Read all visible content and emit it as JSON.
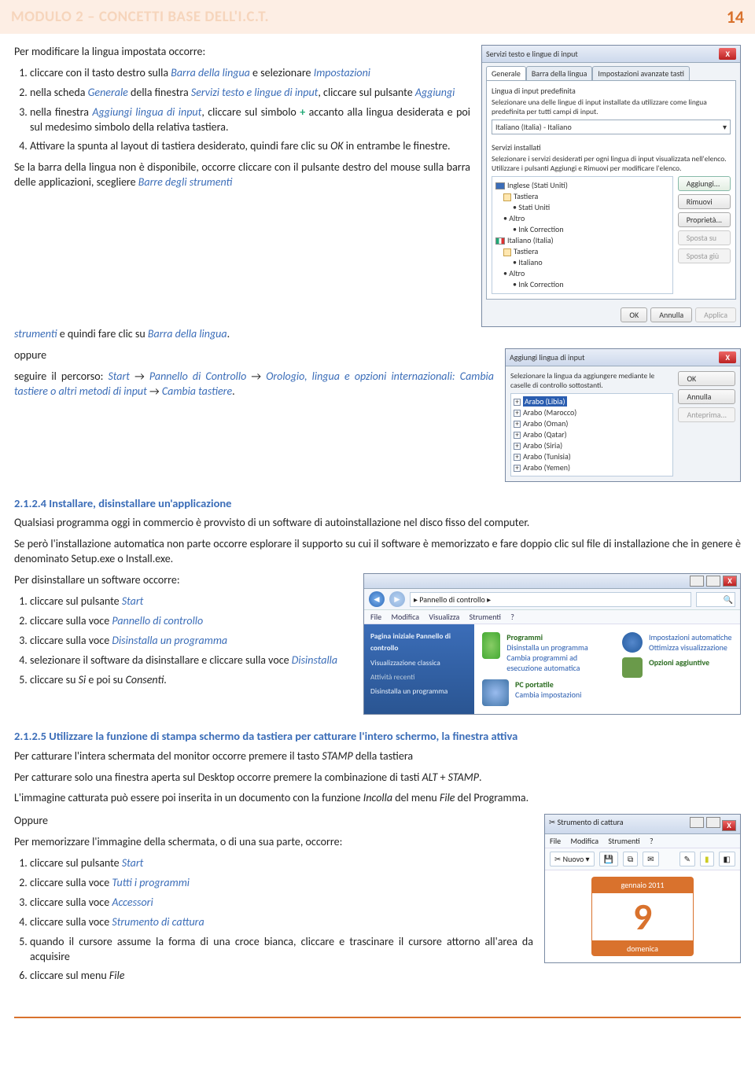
{
  "header": {
    "title": "MODULO 2 – CONCETTI BASE DELL'I.C.T.",
    "page": "14"
  },
  "intro": "Per modificare la lingua impostata occorre:",
  "steps1": {
    "s1a": "cliccare con il tasto destro sulla ",
    "s1b": "Barra della lingua",
    "s1c": " e selezionare ",
    "s1d": "Impostazioni",
    "s2a": "nella scheda ",
    "s2b": "Generale",
    "s2c": " della finestra ",
    "s2d": "Servizi testo e lingue di input",
    "s2e": ", cliccare sul pulsante ",
    "s2f": "Aggiungi",
    "s3a": "nella finestra ",
    "s3b": "Aggiungi lingua di input",
    "s3c": ", cliccare sul simbolo ",
    "s3plus": "+",
    "s3d": " accanto alla lingua desiderata e poi sul medesimo simbolo della relativa tastiera.",
    "s4a": "Attivare la spunta al layout di tastiera desiderato, quindi fare clic su ",
    "s4b": "OK",
    "s4c": " in entrambe le finestre."
  },
  "para1": {
    "a": "Se la barra della lingua non è disponibile, occorre cliccare con il pulsante destro del mouse sulla barra delle applicazioni, scegliere ",
    "b": "Barre degli strumenti",
    "c": " e quindi fare clic su ",
    "d": "Barra della lingua",
    "e": "."
  },
  "para2": {
    "a": "oppure",
    "b": "seguire il percorso: ",
    "c": "Start",
    "d": " → ",
    "e": "Pannello di Controllo",
    "f": " → ",
    "g": "Orologio, lingua e opzioni internazionali: Cambia tastiere o altri metodi di input",
    "h": " → ",
    "i": "Cambia tastiere",
    "j": "."
  },
  "sec4": {
    "hdr": "2.1.2.4  Installare, disinstallare un'applicazione",
    "p1": "Qualsiasi programma oggi in commercio è provvisto di un software di autoinstallazione nel disco fisso del computer.",
    "p2": "Se però l'installazione automatica non parte occorre esplorare il supporto su cui il software è memorizzato e fare doppio clic sul file di installazione che in genere è denominato Setup.exe o Install.exe.",
    "p3": "Per disinstallare un software occorre:",
    "li1a": "cliccare sul pulsante ",
    "li1b": "Start",
    "li2a": "cliccare sulla voce ",
    "li2b": "Pannello di controllo",
    "li3a": "cliccare sulla voce ",
    "li3b": "Disinstalla un programma",
    "li4a": "selezionare il software da disinstallare  e cliccare sulla voce ",
    "li4b": "Disinstalla",
    "li5a": "cliccare su ",
    "li5b": "Si",
    "li5c": " e poi su ",
    "li5d": "Consenti",
    "li5e": "."
  },
  "sec5": {
    "hdr": "2.1.2.5  Utilizzare la funzione di stampa schermo da tastiera per catturare l'intero schermo, la finestra attiva",
    "p1a": "Per catturare l'intera schermata del monitor occorre premere il tasto ",
    "p1b": "STAMP",
    "p1c": " della tastiera",
    "p2a": "Per catturare solo una finestra aperta sul Desktop occorre premere la combinazione di tasti ",
    "p2b": "ALT",
    "p2c": " + ",
    "p2d": "STAMP",
    "p2e": ".",
    "p3a": "L'immagine catturata può essere poi inserita in un documento con la funzione ",
    "p3b": "Incolla",
    "p3c": " del menu ",
    "p3d": "File",
    "p3e": " del Programma.",
    "opp": "Oppure",
    "p4": "Per memorizzare l'immagine della schermata, o di una sua parte, occorre:",
    "li1a": "cliccare sul pulsante ",
    "li1b": "Start",
    "li2a": "cliccare sulla voce ",
    "li2b": "Tutti i programmi",
    "li3a": "cliccare sulla voce ",
    "li3b": "Accessori",
    "li4a": "cliccare sulla voce ",
    "li4b": "Strumento di cattura",
    "li5": "quando il cursore assume la forma di una croce bianca, cliccare e trascinare il cursore attorno all'area da acquisire",
    "li6a": "cliccare sul menu ",
    "li6b": "File"
  },
  "dlg1": {
    "title": "Servizi testo e lingue di input",
    "tabs": [
      "Generale",
      "Barra della lingua",
      "Impostazioni avanzate tasti"
    ],
    "grp1": "Lingua di input predefinita",
    "grp1txt": "Selezionare una delle lingue di input installate da utilizzare come lingua predefinita per tutti campi di input.",
    "combo": "Italiano (Italia) - Italiano",
    "grp2": "Servizi installati",
    "grp2txt": "Selezionare i servizi desiderati per ogni lingua di input visualizzata nell'elenco. Utilizzare i pulsanti Aggiungi e Rimuovi per modificare l'elenco.",
    "tree": {
      "en": "Inglese (Stati Uniti)",
      "ent": "Tastiera",
      "ens": "Stati Uniti",
      "alt": "Altro",
      "ink": "Ink Correction",
      "it": "Italiano (Italia)",
      "itt": "Tastiera",
      "its": "Italiano"
    },
    "btns": {
      "add": "Aggiungi...",
      "rem": "Rimuovi",
      "prop": "Proprietà...",
      "up": "Sposta su",
      "dn": "Sposta giù"
    },
    "ok": "OK",
    "cancel": "Annulla",
    "apply": "Applica"
  },
  "dlg2": {
    "title": "Aggiungi lingua di input",
    "txt": "Selezionare la lingua da aggiungere mediante le caselle di controllo sottostanti.",
    "items": [
      "Arabo (Libia)",
      "Arabo (Marocco)",
      "Arabo (Oman)",
      "Arabo (Qatar)",
      "Arabo (Siria)",
      "Arabo (Tunisia)",
      "Arabo (Yemen)"
    ],
    "ok": "OK",
    "cancel": "Annulla",
    "prev": "Anteprima..."
  },
  "cp": {
    "addr": "▸ Pannello di controllo ▸",
    "menu": [
      "File",
      "Modifica",
      "Visualizza",
      "Strumenti",
      "?"
    ],
    "side": [
      "Pagina iniziale Pannello di controllo",
      "Visualizzazione classica",
      "Attività recenti",
      "Disinstalla un programma"
    ],
    "prog": {
      "t": "Programmi",
      "l1": "Disinstalla un programma",
      "l2": "Cambia programmi ad esecuzione automatica"
    },
    "pc": {
      "t": "PC portatile",
      "l1": "Cambia impostazioni"
    },
    "r1": "Impostazioni automatiche",
    "r2": "Ottimizza visualizzazione",
    "r3": "Opzioni aggiuntive"
  },
  "snip": {
    "title": "Strumento di cattura",
    "menu": [
      "File",
      "Modifica",
      "Strumenti",
      "?"
    ],
    "nuovo": "Nuovo",
    "cal": {
      "month": "gennaio 2011",
      "day": "9",
      "dow": "domenica"
    }
  }
}
